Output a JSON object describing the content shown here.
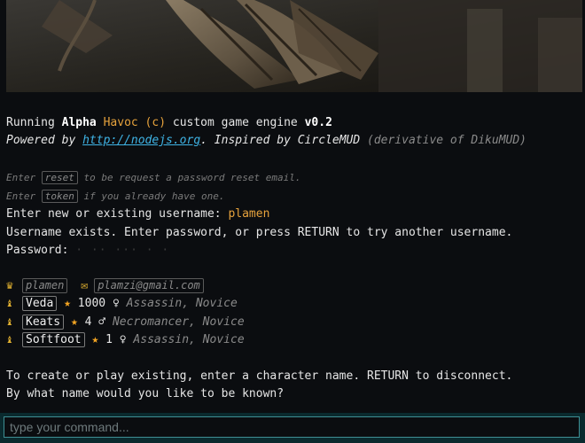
{
  "intro": {
    "running": "Running ",
    "alpha": "Alpha",
    "havoc": " Havoc",
    "copyright": " (c) ",
    "engine": "custom game engine ",
    "version": "v0.2",
    "powered_by": "Powered by ",
    "link": "http://nodejs.org",
    "inspired": ". Inspired by CircleMUD ",
    "derivative": "(derivative of DikuMUD)"
  },
  "hints": {
    "enter1": "Enter ",
    "reset_key": "reset",
    "reset_text": " to be request a password reset email.",
    "enter2": "Enter ",
    "token_key": "token",
    "token_text": " if you already have one."
  },
  "prompts": {
    "username_prompt": "Enter new or existing username: ",
    "username_value": "plamen",
    "exists": "Username exists. Enter password, or press RETURN to try another username.",
    "password_label": "Password: ",
    "password_mask": "· ·· ··· · ·"
  },
  "account": {
    "crown_icon": "♛",
    "mail_icon": "✉",
    "username": "plamen",
    "email": "plamzi@gmail.com"
  },
  "characters": [
    {
      "icon": "♝",
      "name": "Veda",
      "star": "★",
      "level": "1000",
      "gender": "♀",
      "cls": "Assassin, Novice"
    },
    {
      "icon": "♝",
      "name": "Keats",
      "star": "★",
      "level": "4",
      "gender": "♂",
      "cls": "Necromancer, Novice"
    },
    {
      "icon": "♝",
      "name": "Softfoot",
      "star": "★",
      "level": "1",
      "gender": "♀",
      "cls": "Assassin, Novice"
    }
  ],
  "footer": {
    "create": "To create or play existing, enter a character name. RETURN to disconnect.",
    "known": "By what name would you like to be known?"
  },
  "command": {
    "placeholder": "type your command..."
  }
}
